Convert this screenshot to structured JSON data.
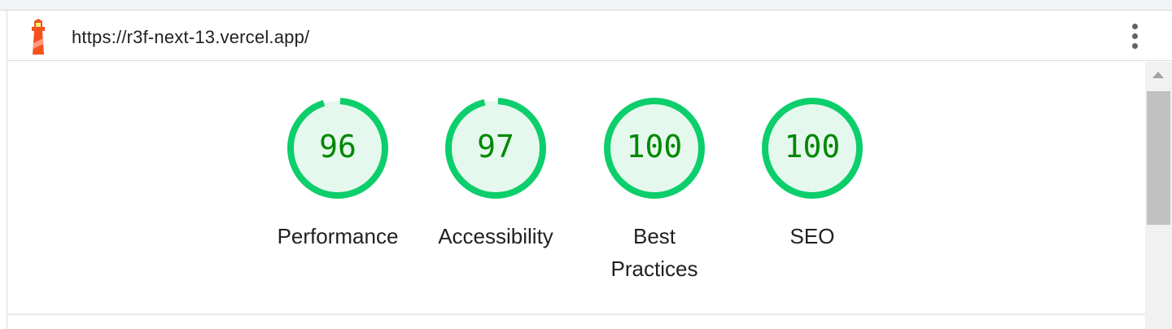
{
  "header": {
    "url": "https://r3f-next-13.vercel.app/",
    "logo_icon": "lighthouse-icon",
    "menu_icon": "more-vert-icon"
  },
  "gauges": [
    {
      "label": "Performance",
      "value": "96",
      "score": 0.96
    },
    {
      "label": "Accessibility",
      "value": "97",
      "score": 0.97
    },
    {
      "label": "Best\nPractices",
      "value": "100",
      "score": 1.0
    },
    {
      "label": "SEO",
      "value": "100",
      "score": 1.0
    }
  ],
  "colors": {
    "pass_ring": "#0cce6b",
    "pass_fill": "#e5f8ee",
    "pass_text": "#008800"
  }
}
